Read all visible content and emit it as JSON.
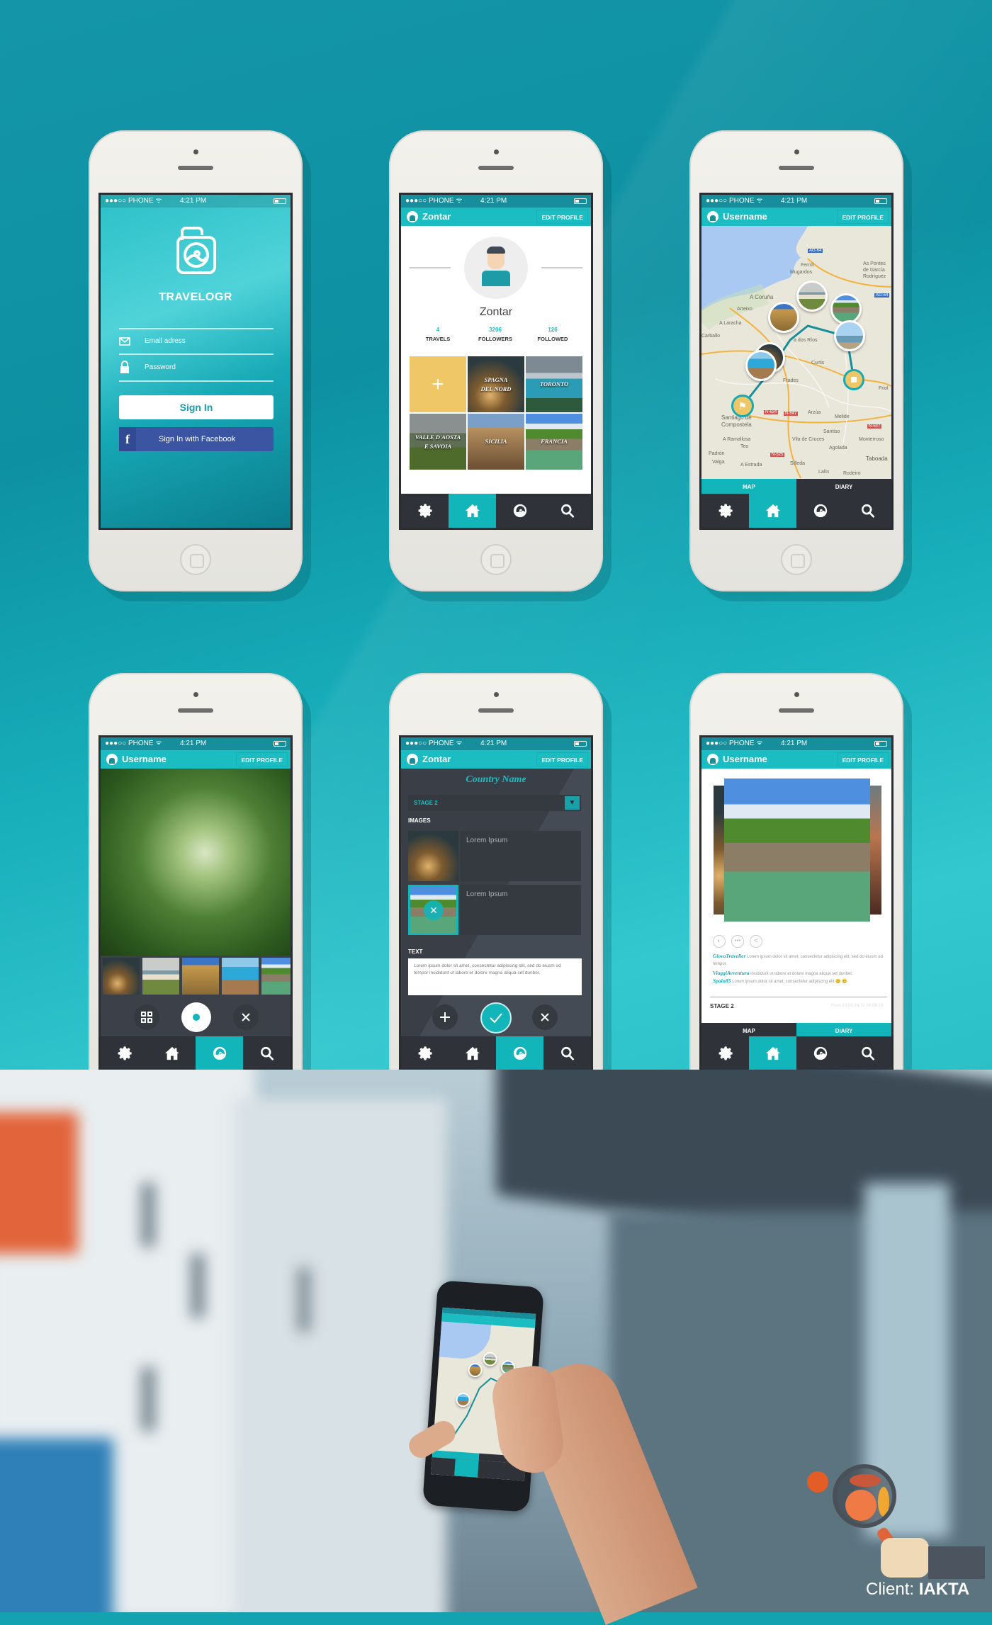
{
  "status": {
    "carrier": "●●●○○ PHONE ᯤ",
    "time": "4:21 PM"
  },
  "colors": {
    "accent": "#1bbcc2",
    "accent_active": "#11b5ba",
    "nav_bg": "#2f3339",
    "album_add": "#efc766",
    "facebook": "#3b55a3",
    "map_marker": "#efc766"
  },
  "nav": {
    "icons": [
      "gear-icon",
      "home-icon",
      "camera-icon",
      "search-icon"
    ]
  },
  "login": {
    "app_name": "TRAVELOGR",
    "email_placeholder": "Email adress",
    "password_placeholder": "Password",
    "sign_in": "Sign In",
    "facebook": "Sign In with Facebook"
  },
  "profile": {
    "header_name": "Zontar",
    "edit": "EDIT PROFILE",
    "name": "Zontar",
    "stats": [
      {
        "value": "4",
        "label": "TRAVELS"
      },
      {
        "value": "3206",
        "label": "FOLLOWERS"
      },
      {
        "value": "126",
        "label": "FOLLOWED"
      }
    ],
    "albums": [
      {
        "l1": "SPAGNA",
        "l2": "DEL NORD"
      },
      {
        "l1": "TORONTO",
        "l2": ""
      },
      {
        "l1": "VALLE D'AOSTA",
        "l2": "E SAVOIA"
      },
      {
        "l1": "SICILIA",
        "l2": ""
      },
      {
        "l1": "FRANCIA",
        "l2": ""
      }
    ],
    "active_nav": "home"
  },
  "map": {
    "header_name": "Username",
    "edit": "EDIT PROFILE",
    "tabs": [
      "MAP",
      "DIARY"
    ],
    "active_tab": "MAP",
    "labels": [
      "Ferrol",
      "Mugardos",
      "As Pontes",
      "de García",
      "Rodríguez",
      "A Coruña",
      "Arteixo",
      "A Laracha",
      "Carballo",
      "Curtis",
      "Frades",
      "Arzúa",
      "Melide",
      "Friol",
      "Santiago de",
      "Compostela",
      "Santiso",
      "A Ramallosa",
      "Teo",
      "Vila de Cruces",
      "Agolada",
      "Monterroso",
      "Padrón",
      "Valga",
      "A Estrada",
      "Silleda",
      "Taboada",
      "Lalín",
      "Rodeiro",
      "a dos Ríos"
    ],
    "roads": [
      "AG-64",
      "N-634",
      "N-547",
      "N-525",
      "AG-64",
      "N-547"
    ],
    "active_nav": "home"
  },
  "camera": {
    "header_name": "Username",
    "edit": "EDIT PROFILE",
    "active_nav": "camera"
  },
  "editor": {
    "header_name": "Zontar",
    "edit": "EDIT PROFILE",
    "title": "Country Name",
    "stage": "STAGE 2",
    "images_label": "IMAGES",
    "captions": [
      "Lorem Ipsum",
      "Lorem Ipsum"
    ],
    "text_label": "TEXT",
    "text": "Lorem ipsum dolor sit amet, consectetur adipiscing elit, sed do eiusm od tempor incididunt ut labore et dolore magna aliqua set dunber.",
    "active_nav": "camera"
  },
  "diary": {
    "header_name": "Username",
    "edit": "EDIT PROFILE",
    "comments": [
      {
        "user": "GiovaTraveller",
        "text": "Lorem ipsum dolor sit amet, consectetur adipiscing elit, sed do eiusm od tempor."
      },
      {
        "user": "ViaggiAvventura",
        "text": "incididunt ut labore et dolore magna aliqua set dunber."
      },
      {
        "user": "Spain85",
        "text": "Lorem ipsum dolor sit amet, consectetur adipiscing elit 😊 😊"
      }
    ],
    "stage": "STAGE 2",
    "dates": "From 15-03-16 To 16-04-16",
    "tabs": [
      "MAP",
      "DIARY"
    ],
    "active_tab": "DIARY",
    "active_nav": "home"
  },
  "client": {
    "label": "Client: ",
    "name": "IAKTA"
  }
}
